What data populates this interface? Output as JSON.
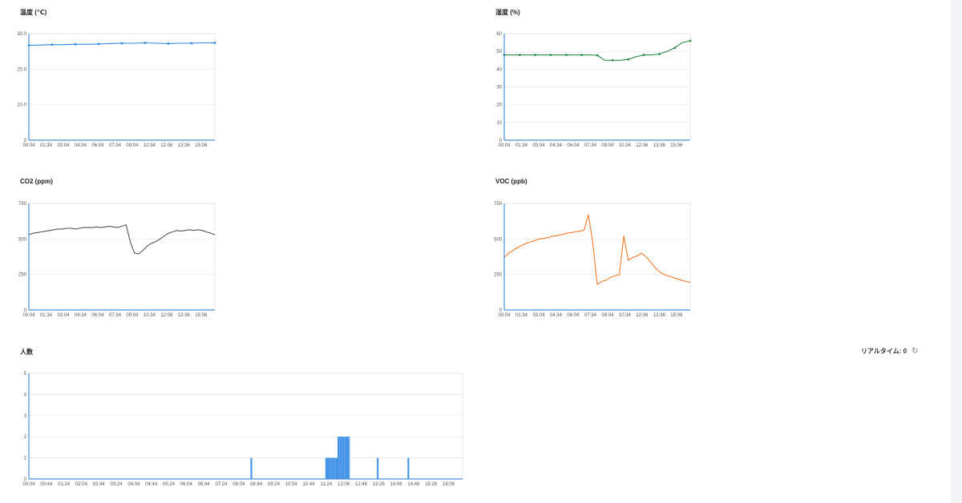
{
  "panels": [
    {
      "id": "temp",
      "title": "温度 (℃)",
      "chart_data": {
        "type": "line",
        "title": "温度 (℃)",
        "color": "#2f86e0",
        "ylim": [
          0,
          30
        ],
        "yticks": [
          "0",
          "10.0",
          "20.0",
          "30.0"
        ],
        "ytick_values": [
          0,
          10,
          20,
          30
        ],
        "xticks": [
          "00:04",
          "01:34",
          "03:04",
          "04:34",
          "06:04",
          "07:34",
          "09:04",
          "10:34",
          "12:06",
          "13:36",
          "15:06"
        ],
        "x_count": 11,
        "series": [
          {
            "values": [
              26.7,
              26.8,
              26.9,
              26.9,
              27.0,
              27.0,
              27.1,
              27.2,
              27.3,
              27.3,
              27.4,
              27.3,
              27.2,
              27.3,
              27.3,
              27.4,
              27.4
            ],
            "markers": true
          }
        ]
      }
    },
    {
      "id": "humidity",
      "title": "湿度 (%)",
      "chart_data": {
        "type": "line",
        "title": "湿度 (%)",
        "color": "#2e8b4a",
        "ylim": [
          0,
          60
        ],
        "yticks": [
          "0",
          "10",
          "20",
          "30",
          "40",
          "50",
          "60"
        ],
        "ytick_values": [
          0,
          10,
          20,
          30,
          40,
          50,
          60
        ],
        "xticks": [
          "00:04",
          "01:34",
          "03:04",
          "04:34",
          "06:04",
          "07:34",
          "09:04",
          "10:34",
          "12:06",
          "13:36",
          "15:06"
        ],
        "x_count": 11,
        "series": [
          {
            "values": [
              48,
              48,
              48,
              48,
              48,
              48,
              48,
              48,
              48,
              48,
              48,
              48,
              47.8,
              45,
              45,
              45,
              45.5,
              47,
              48,
              48,
              48.5,
              50,
              52,
              55,
              56
            ],
            "markers": true
          }
        ]
      }
    },
    {
      "id": "co2",
      "title": "CO2 (ppm)",
      "chart_data": {
        "type": "line",
        "title": "CO2 (ppm)",
        "color": "#555555",
        "ylim": [
          0,
          750
        ],
        "yticks": [
          "0",
          "250",
          "500",
          "750"
        ],
        "ytick_values": [
          0,
          250,
          500,
          750
        ],
        "xticks": [
          "00:04",
          "01:34",
          "03:04",
          "04:34",
          "06:04",
          "07:34",
          "09:04",
          "10:34",
          "12:06",
          "13:36",
          "15:06"
        ],
        "x_count": 11,
        "series": [
          {
            "values": [
              530,
              540,
              545,
              550,
              555,
              560,
              565,
              570,
              570,
              575,
              575,
              570,
              575,
              580,
              580,
              580,
              585,
              580,
              585,
              590,
              585,
              580,
              590,
              600,
              480,
              400,
              395,
              420,
              450,
              470,
              480,
              500,
              520,
              540,
              550,
              560,
              555,
              560,
              565,
              560,
              565,
              560,
              550,
              540,
              530
            ],
            "markers": false
          }
        ]
      }
    },
    {
      "id": "voc",
      "title": "VOC (ppb)",
      "chart_data": {
        "type": "line",
        "title": "VOC (ppb)",
        "color": "#f07a2a",
        "ylim": [
          0,
          750
        ],
        "yticks": [
          "0",
          "250",
          "500",
          "750"
        ],
        "ytick_values": [
          0,
          250,
          500,
          750
        ],
        "xticks": [
          "00:04",
          "01:34",
          "03:04",
          "04:34",
          "06:04",
          "07:34",
          "09:04",
          "10:34",
          "12:06",
          "13:36",
          "15:06"
        ],
        "x_count": 11,
        "series": [
          {
            "values": [
              370,
              400,
              420,
              440,
              455,
              470,
              480,
              490,
              500,
              505,
              510,
              520,
              525,
              530,
              540,
              545,
              550,
              555,
              560,
              670,
              470,
              180,
              200,
              210,
              230,
              240,
              250,
              520,
              350,
              370,
              380,
              400,
              375,
              340,
              300,
              270,
              250,
              240,
              230,
              220,
              210,
              200,
              195
            ],
            "markers": false
          }
        ]
      }
    },
    {
      "id": "people",
      "title": "人数",
      "chart_data": {
        "type": "bar",
        "title": "人数",
        "color": "#3a8ee6",
        "ylim": [
          0,
          5
        ],
        "yticks": [
          "0",
          "1",
          "2",
          "3",
          "4",
          "5"
        ],
        "ytick_values": [
          0,
          1,
          2,
          3,
          4,
          5
        ],
        "xticks": [
          "00:04",
          "00:44",
          "01:24",
          "02:04",
          "02:44",
          "03:24",
          "04:04",
          "04:44",
          "05:24",
          "06:04",
          "06:44",
          "07:24",
          "08:04",
          "08:44",
          "09:24",
          "10:04",
          "10:44",
          "11:24",
          "12:06",
          "12:46",
          "13:26",
          "14:06",
          "14:46",
          "15:26",
          "16:06"
        ],
        "x_count": 25,
        "bars": [
          {
            "x": 12.72,
            "value": 1
          },
          {
            "x": 17.0,
            "value": 1
          },
          {
            "x": 17.1,
            "value": 1
          },
          {
            "x": 17.2,
            "value": 1
          },
          {
            "x": 17.3,
            "value": 1
          },
          {
            "x": 17.4,
            "value": 1
          },
          {
            "x": 17.5,
            "value": 1
          },
          {
            "x": 17.6,
            "value": 1
          },
          {
            "x": 17.7,
            "value": 2
          },
          {
            "x": 17.8,
            "value": 2
          },
          {
            "x": 17.9,
            "value": 2
          },
          {
            "x": 18.0,
            "value": 2
          },
          {
            "x": 18.1,
            "value": 2
          },
          {
            "x": 18.2,
            "value": 2
          },
          {
            "x": 18.3,
            "value": 2
          },
          {
            "x": 19.95,
            "value": 1
          },
          {
            "x": 21.7,
            "value": 1
          }
        ]
      }
    }
  ],
  "realtime": {
    "label": "リアルタイム: 0",
    "icon": "refresh-icon"
  }
}
